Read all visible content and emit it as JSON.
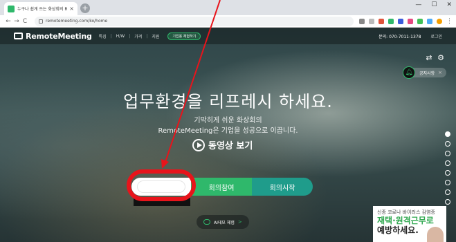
{
  "browser": {
    "tab_title": "누구나 쉽게 쓰는 화상회의 RemoteMeeting",
    "tab_close": "×",
    "new_tab": "+",
    "window_controls": [
      "—",
      "☐",
      "✕"
    ],
    "url": "remotemeeting.com/ko/home",
    "nav": {
      "back": "←",
      "forward": "→",
      "reload": "C"
    }
  },
  "header": {
    "logo": "RemoteMeeting",
    "menu": [
      "특징",
      "H/W",
      "가격",
      "지원"
    ],
    "trial_button": "기업용 체험하기",
    "phone": "문의: 070-7011-1378",
    "login": "로그인"
  },
  "notice": {
    "label": "공지사항",
    "close": "×"
  },
  "hero": {
    "headline": "업무환경을 리프레시 하세요.",
    "sub1": "기막히게 쉬운 화상회의",
    "sub2": "RemoteMeeting은 기업을 성공으로 이끕니다.",
    "video_label": "동영상 보기"
  },
  "actions": {
    "join": "회의참여",
    "start": "회의시작"
  },
  "ai_demo": {
    "label": "AI데모 체험",
    "arrow": ">"
  },
  "ad": {
    "line1": "신종 코로나 바이러스 감염증",
    "line2": "재택·원격근무로",
    "line3": "예방하세요."
  },
  "colors": {
    "accent_green": "#2fb86b",
    "start_teal": "#1f9c8b",
    "annotation_red": "#e8141b"
  }
}
